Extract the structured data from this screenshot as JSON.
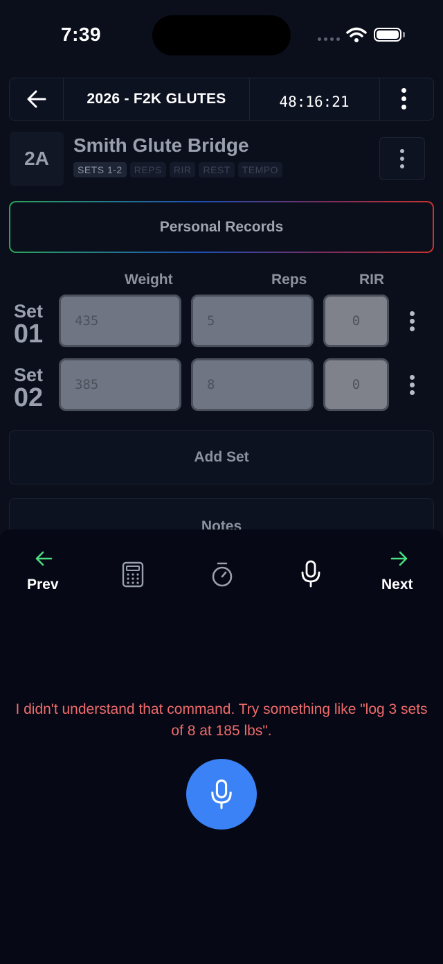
{
  "status": {
    "time": "7:39"
  },
  "header": {
    "title": "2026 - F2K GLUTES",
    "timer": "48:16:21"
  },
  "exercise": {
    "badge": "2A",
    "name": "Smith Glute Bridge",
    "tags": [
      "SETS 1-2",
      "REPS",
      "RIR",
      "REST",
      "TEMPO"
    ]
  },
  "personal_records": {
    "label": "Personal Records"
  },
  "columns": {
    "weight": "Weight",
    "reps": "Reps",
    "rir": "RIR"
  },
  "sets": [
    {
      "label": "Set",
      "number": "01",
      "weight": "435",
      "reps": "5",
      "rir": "0"
    },
    {
      "label": "Set",
      "number": "02",
      "weight": "385",
      "reps": "8",
      "rir": "0"
    }
  ],
  "actions": {
    "add_set": "Add Set",
    "notes": "Notes"
  },
  "toolbar": {
    "prev": "Prev",
    "next": "Next"
  },
  "voice": {
    "message": "I didn't understand that command. Try something like \"log 3 sets of 8 at 185 lbs\"."
  },
  "colors": {
    "accent": "#3b82f6",
    "nav_arrow": "#4ade80",
    "error": "#ef6b6b",
    "background": "#0b0f1c"
  },
  "icons": [
    "back-arrow-icon",
    "more-vertical-icon",
    "calculator-icon",
    "stopwatch-icon",
    "microphone-icon",
    "arrow-left-icon",
    "arrow-right-icon",
    "wifi-icon",
    "battery-icon"
  ]
}
